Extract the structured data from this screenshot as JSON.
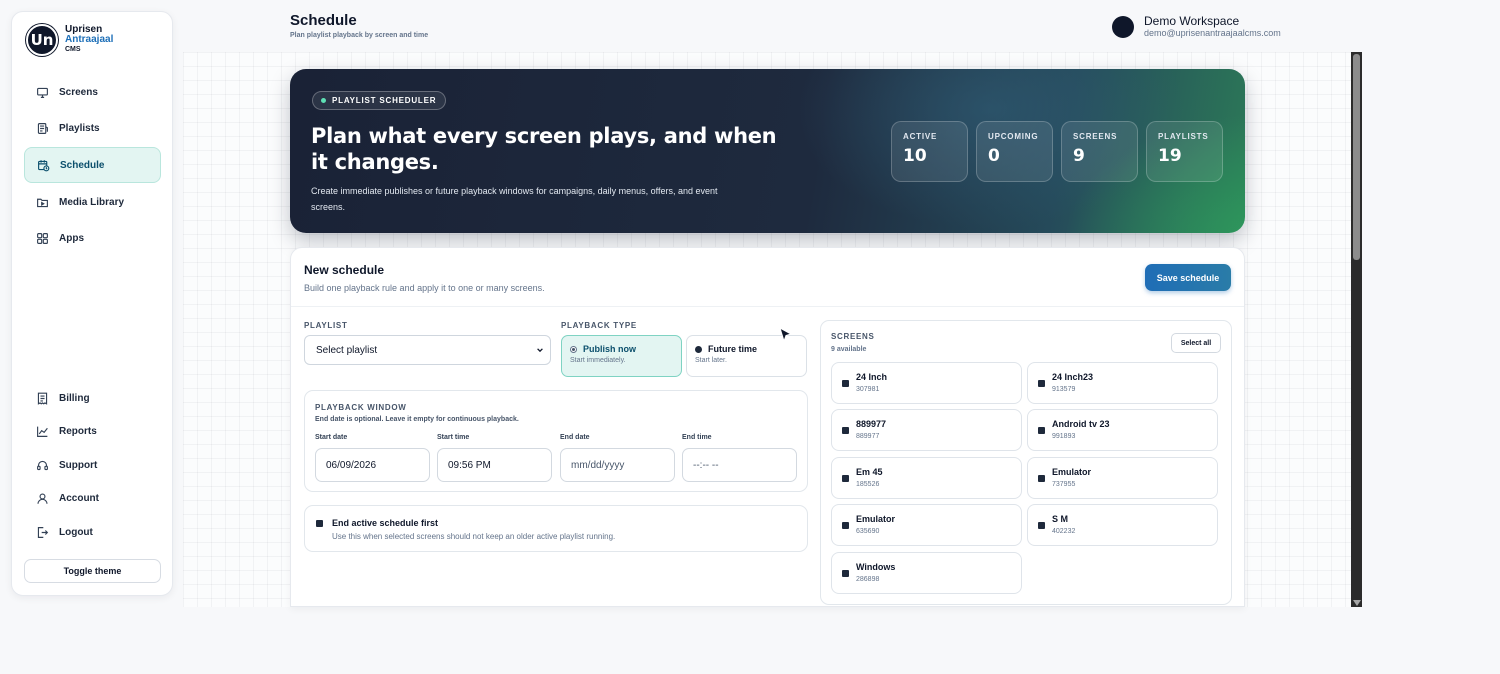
{
  "brand": {
    "line1": "Uprisen",
    "line2": "Antraajaal",
    "line3": "CMS",
    "logo_text": "Un"
  },
  "sidebar": {
    "items": [
      {
        "label": "Screens",
        "icon": "monitor-icon"
      },
      {
        "label": "Playlists",
        "icon": "playlist-icon"
      },
      {
        "label": "Schedule",
        "icon": "calendar-clock-icon",
        "active": true
      },
      {
        "label": "Media Library",
        "icon": "folder-play-icon"
      },
      {
        "label": "Apps",
        "icon": "apps-grid-icon"
      }
    ],
    "bottom_items": [
      {
        "label": "Billing",
        "icon": "receipt-icon"
      },
      {
        "label": "Reports",
        "icon": "chart-icon"
      },
      {
        "label": "Support",
        "icon": "headset-icon"
      },
      {
        "label": "Account",
        "icon": "user-icon"
      },
      {
        "label": "Logout",
        "icon": "logout-icon"
      }
    ],
    "toggle_theme": "Toggle theme"
  },
  "header": {
    "title": "Schedule",
    "subtitle": "Plan playlist playback by screen and time",
    "workspace_name": "Demo Workspace",
    "workspace_email": "demo@uprisenantraajaalcms.com"
  },
  "hero": {
    "badge": "PLAYLIST SCHEDULER",
    "title": "Plan what every screen plays, and when it changes.",
    "description": "Create immediate publishes or future playback windows for campaigns, daily menus, offers, and event screens.",
    "stats": [
      {
        "label": "ACTIVE",
        "value": "10"
      },
      {
        "label": "UPCOMING",
        "value": "0"
      },
      {
        "label": "SCREENS",
        "value": "9"
      },
      {
        "label": "PLAYLISTS",
        "value": "19"
      }
    ]
  },
  "form": {
    "title": "New schedule",
    "subtitle": "Build one playback rule and apply it to one or many screens.",
    "save_label": "Save schedule",
    "playlist_label": "PLAYLIST",
    "playlist_value": "Select playlist",
    "playback_type_label": "PLAYBACK TYPE",
    "playback_types": [
      {
        "title": "Publish now",
        "sub": "Start immediately.",
        "selected": true
      },
      {
        "title": "Future time",
        "sub": "Start later.",
        "selected": false
      }
    ],
    "window": {
      "label": "PLAYBACK WINDOW",
      "note": "End date is optional. Leave it empty for continuous playback.",
      "start_date_label": "Start date",
      "start_date": "06/09/2026",
      "start_time_label": "Start time",
      "start_time": "09:56 PM",
      "end_date_label": "End date",
      "end_date_placeholder": "mm/dd/yyyy",
      "end_time_label": "End time",
      "end_time_placeholder": "--:-- --"
    },
    "end_active": {
      "title": "End active schedule first",
      "sub": "Use this when selected screens should not keep an older active playlist running."
    }
  },
  "screens": {
    "label": "SCREENS",
    "count": "9 available",
    "select_all": "Select all",
    "items": [
      {
        "name": "24 Inch",
        "id": "307981"
      },
      {
        "name": "24 Inch23",
        "id": "913579"
      },
      {
        "name": "889977",
        "id": "889977"
      },
      {
        "name": "Android tv 23",
        "id": "991893"
      },
      {
        "name": "Em 45",
        "id": "185526"
      },
      {
        "name": "Emulator",
        "id": "737955"
      },
      {
        "name": "Emulator",
        "id": "635690"
      },
      {
        "name": "S M",
        "id": "402232"
      },
      {
        "name": "Windows",
        "id": "286898"
      }
    ]
  },
  "colors": {
    "accent": "#1f6db6",
    "active_nav_bg": "#e3f5f2",
    "hero_dark": "#1a2236",
    "hero_green": "#2ea05d"
  }
}
